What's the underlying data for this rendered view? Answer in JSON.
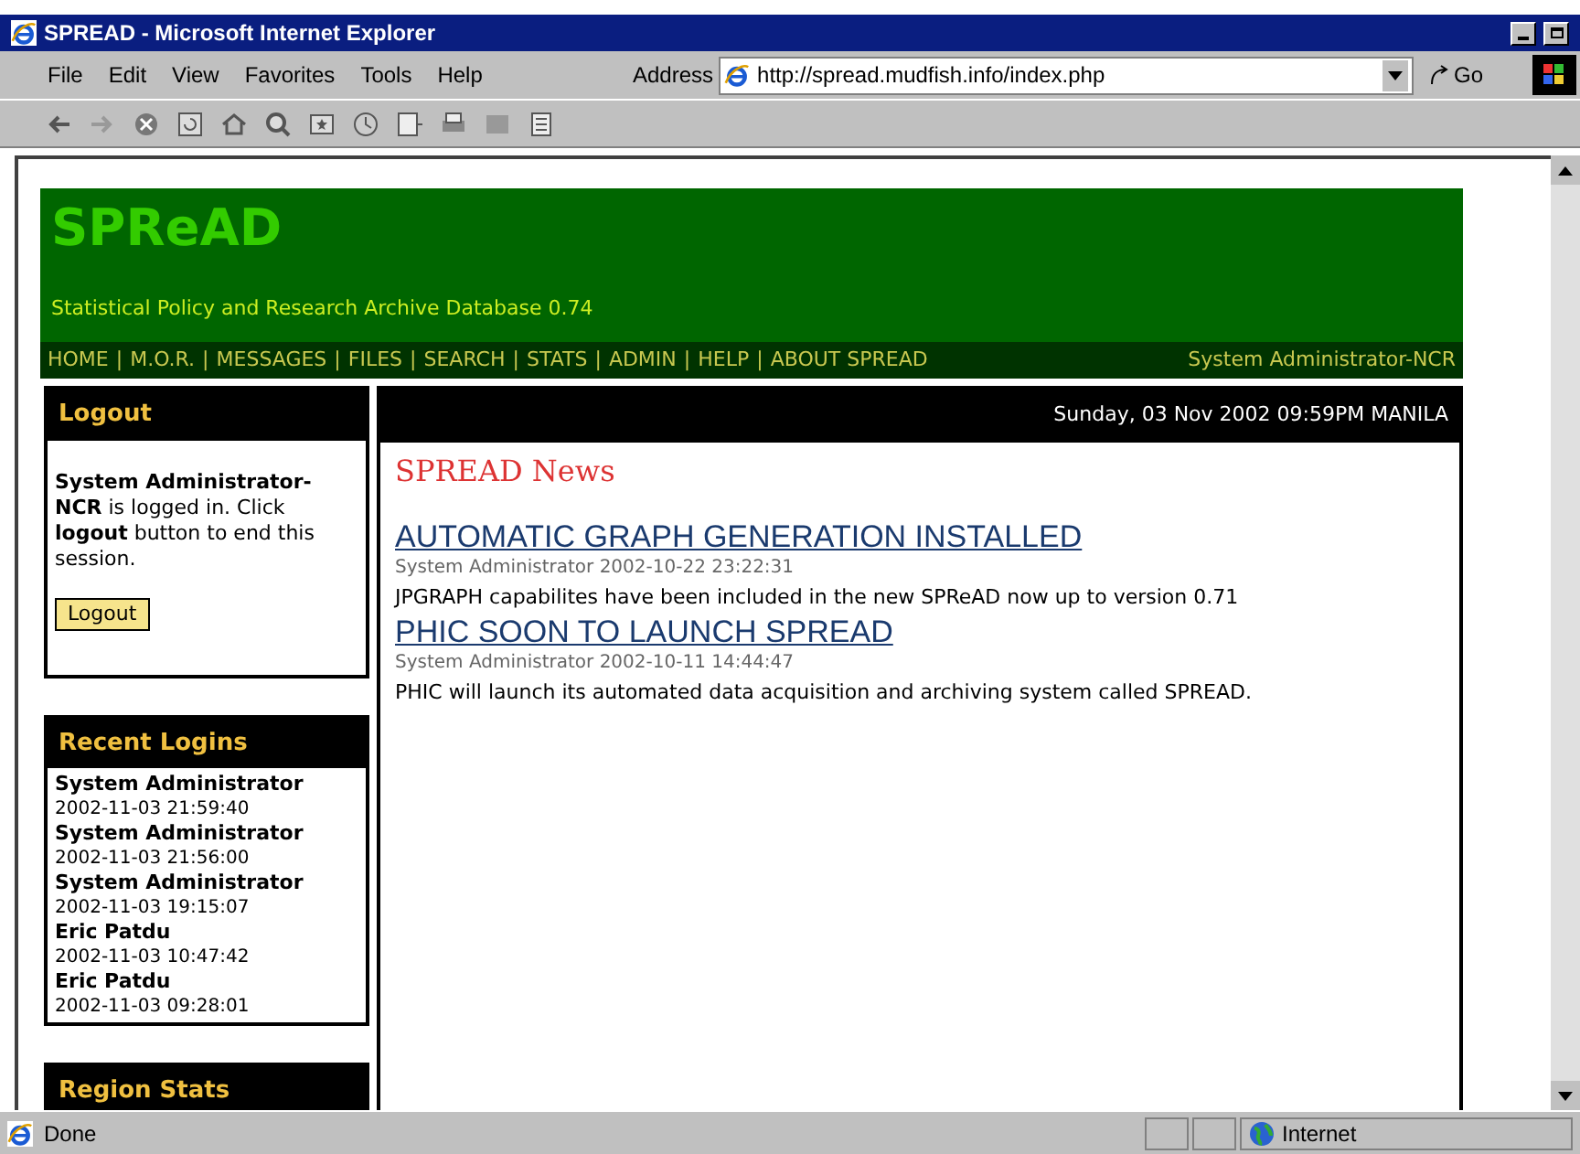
{
  "window": {
    "title": "SPREAD - Microsoft Internet Explorer"
  },
  "menu": [
    "File",
    "Edit",
    "View",
    "Favorites",
    "Tools",
    "Help"
  ],
  "address": {
    "label": "Address",
    "value": "http://spread.mudfish.info/index.php",
    "go": "Go"
  },
  "site": {
    "title": "SPReAD",
    "subtitle": "Statistical Policy and Research Archive Database 0.74"
  },
  "nav": [
    "HOME",
    "M.O.R.",
    "MESSAGES",
    "FILES",
    "SEARCH",
    "STATS",
    "ADMIN",
    "HELP",
    "ABOUT SPREAD"
  ],
  "nav_separator": "|",
  "current_user": "System Administrator-NCR",
  "logout_box": {
    "title": "Logout",
    "message": "**System Administrator-NCR** is logged in. Click **logout** button to end this session.",
    "button": "Logout"
  },
  "recent_logins": {
    "title": "Recent Logins",
    "items": [
      {
        "name": "System Administrator",
        "time": "2002-11-03 21:59:40"
      },
      {
        "name": "System Administrator",
        "time": "2002-11-03 21:56:00"
      },
      {
        "name": "System Administrator",
        "time": "2002-11-03 19:15:07"
      },
      {
        "name": "Eric Patdu",
        "time": "2002-11-03 10:47:42"
      },
      {
        "name": "Eric Patdu",
        "time": "2002-11-03 09:28:01"
      }
    ]
  },
  "region_stats": {
    "title": "Region Stats"
  },
  "date": "Sunday, 03 Nov 2002 09:59PM MANILA",
  "news": {
    "heading": "SPREAD News",
    "items": [
      {
        "title": "AUTOMATIC GRAPH GENERATION INSTALLED",
        "meta": "System Administrator 2002-10-22 23:22:31",
        "body": "JPGRAPH capabilites have been included in the new SPReAD now up to version 0.71"
      },
      {
        "title": "PHIC SOON TO LAUNCH SPREAD",
        "meta": "System Administrator 2002-10-11 14:44:47",
        "body": "PHIC will launch its automated data acquisition and archiving system called SPREAD."
      }
    ]
  },
  "status_bar": {
    "text": "Done",
    "zone": "Internet"
  }
}
